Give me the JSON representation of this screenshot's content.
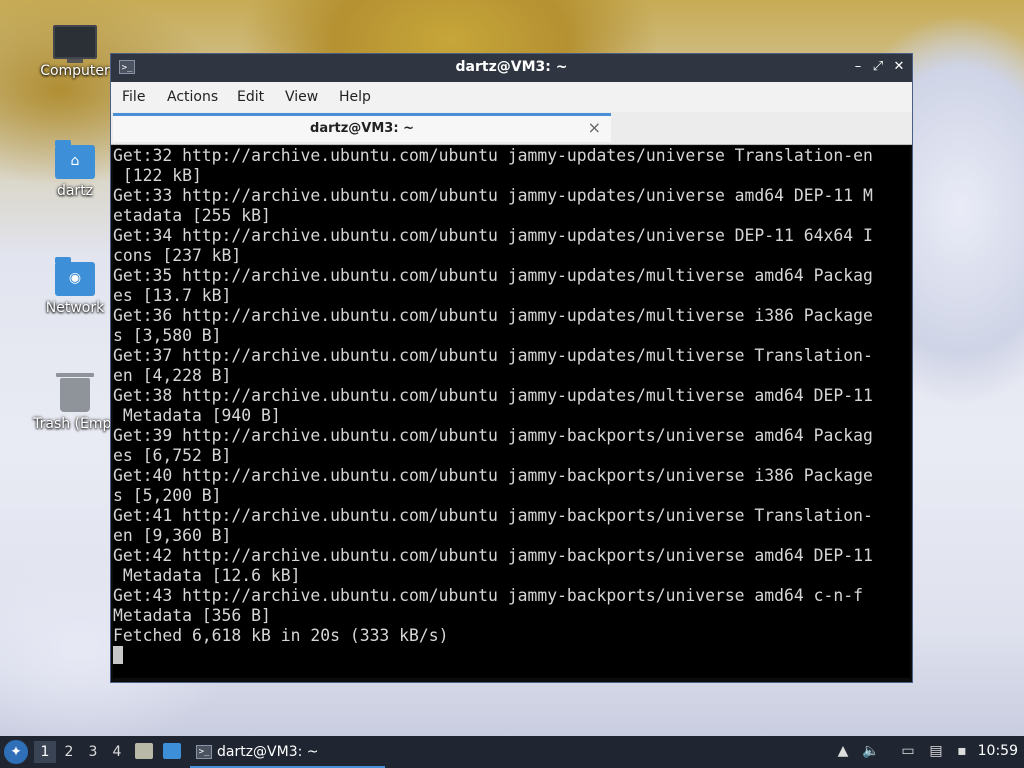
{
  "desktop": {
    "icons": [
      {
        "label": "Computer"
      },
      {
        "label": "dartz"
      },
      {
        "label": "Network"
      },
      {
        "label": "Trash (Empt"
      }
    ]
  },
  "window": {
    "title": "dartz@VM3: ~",
    "menu": [
      "File",
      "Actions",
      "Edit",
      "View",
      "Help"
    ],
    "tab_label": "dartz@VM3: ~",
    "tab_close": "×",
    "controls": {
      "minimize": "–",
      "maximize": "⤢",
      "close": "✕"
    }
  },
  "terminal": {
    "lines": [
      "Get:32 http://archive.ubuntu.com/ubuntu jammy-updates/universe Translation-en",
      " [122 kB]",
      "Get:33 http://archive.ubuntu.com/ubuntu jammy-updates/universe amd64 DEP-11 M",
      "etadata [255 kB]",
      "Get:34 http://archive.ubuntu.com/ubuntu jammy-updates/universe DEP-11 64x64 I",
      "cons [237 kB]",
      "Get:35 http://archive.ubuntu.com/ubuntu jammy-updates/multiverse amd64 Packag",
      "es [13.7 kB]",
      "Get:36 http://archive.ubuntu.com/ubuntu jammy-updates/multiverse i386 Package",
      "s [3,580 B]",
      "Get:37 http://archive.ubuntu.com/ubuntu jammy-updates/multiverse Translation-",
      "en [4,228 B]",
      "Get:38 http://archive.ubuntu.com/ubuntu jammy-updates/multiverse amd64 DEP-11",
      " Metadata [940 B]",
      "Get:39 http://archive.ubuntu.com/ubuntu jammy-backports/universe amd64 Packag",
      "es [6,752 B]",
      "Get:40 http://archive.ubuntu.com/ubuntu jammy-backports/universe i386 Package",
      "s [5,200 B]",
      "Get:41 http://archive.ubuntu.com/ubuntu jammy-backports/universe Translation-",
      "en [9,360 B]",
      "Get:42 http://archive.ubuntu.com/ubuntu jammy-backports/universe amd64 DEP-11",
      " Metadata [12.6 kB]",
      "Get:43 http://archive.ubuntu.com/ubuntu jammy-backports/universe amd64 c-n-f",
      "Metadata [356 B]",
      "Fetched 6,618 kB in 20s (333 kB/s)"
    ]
  },
  "taskbar": {
    "workspaces": [
      "1",
      "2",
      "3",
      "4"
    ],
    "active_workspace": "1",
    "task_label": "dartz@VM3: ~",
    "clock": "10:59"
  },
  "colors": {
    "titlebar": "#2f3641",
    "taskbar": "#1f2631",
    "accent": "#4a90d9",
    "terminal_bg": "#000000",
    "terminal_fg": "#d6d6d6"
  }
}
